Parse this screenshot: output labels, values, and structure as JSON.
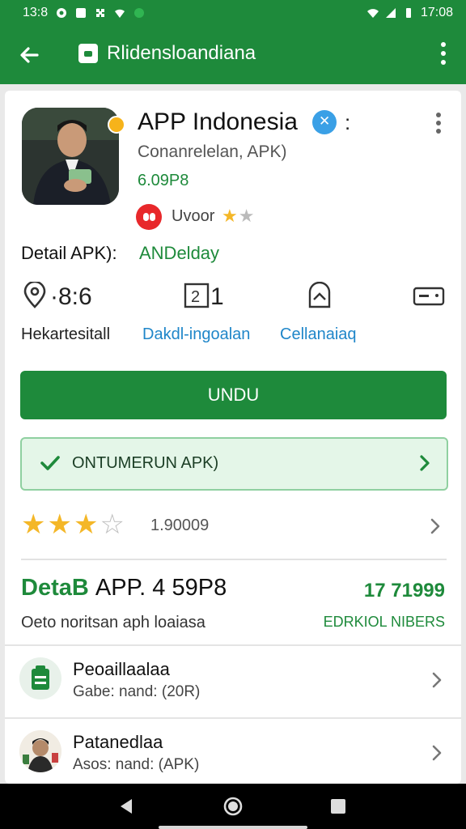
{
  "status_bar": {
    "time_left": "13:8",
    "time_right": "17:08"
  },
  "app_bar": {
    "title": "Rlidensloandiana"
  },
  "app": {
    "name": "APP Indonesia",
    "colon": ":",
    "subtitle": "Conanrelelan, APK)",
    "size": "6.09P8",
    "developer": "Uvoor",
    "developer_stars": "★★",
    "detail_label": "Detail APK):",
    "detail_value": "ANDelday"
  },
  "stats": [
    {
      "value": "·8:6",
      "label": "Hekartesitall",
      "label_color": "#222222",
      "icon": "location-pin-icon"
    },
    {
      "value": "1",
      "label": "Dakdl-ingoalan",
      "label_color": "#1f86c9",
      "icon": "number-box-icon"
    },
    {
      "value": "",
      "label": "Cellanaiaq",
      "label_color": "#1f86c9",
      "icon": "shield-up-icon"
    },
    {
      "value": "",
      "label": "",
      "label_color": "#222222",
      "icon": "card-icon"
    }
  ],
  "download_button": "UNDU",
  "continue_button": "ONTUMERUN APK)",
  "rating": {
    "stars": "★★★☆",
    "filled": 3,
    "count": "1.90009"
  },
  "app_detail": {
    "title_green": "DetaB",
    "title_black": "APP. 4 59P8",
    "number": "17 71999",
    "description": "Oeto noritsan aph loaiasa",
    "link": "EDRKIOL NIBERS"
  },
  "list": [
    {
      "title": "Peoaillaalaa",
      "subtitle": "Gabe: nand: (20R)",
      "icon": "clipboard-icon"
    },
    {
      "title": "Patanedlaa",
      "subtitle": "Asos: nand: (APK)",
      "icon": "avatar"
    }
  ],
  "colors": {
    "brand_green": "#1e8a3b",
    "star_gold": "#f4b728",
    "link_blue": "#1f86c9"
  }
}
